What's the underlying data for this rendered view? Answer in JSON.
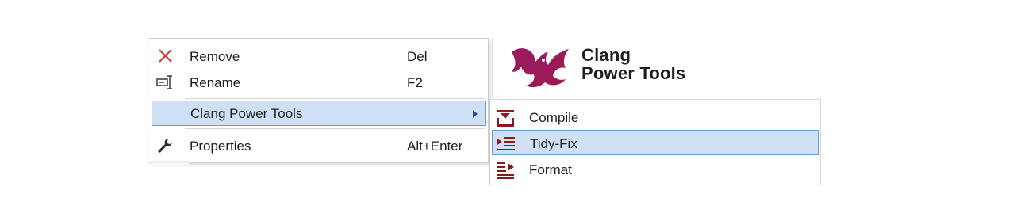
{
  "context_menu": {
    "items": [
      {
        "label": "Remove",
        "shortcut": "Del",
        "icon": "remove-x-icon"
      },
      {
        "label": "Rename",
        "shortcut": "F2",
        "icon": "rename-icon"
      },
      {
        "label": "Clang Power Tools",
        "shortcut": "",
        "icon": "",
        "has_submenu": true,
        "highlighted": true
      },
      {
        "label": "Properties",
        "shortcut": "Alt+Enter",
        "icon": "wrench-icon"
      }
    ]
  },
  "submenu": {
    "items": [
      {
        "label": "Compile",
        "icon": "compile-icon"
      },
      {
        "label": "Tidy-Fix",
        "icon": "tidy-fix-icon",
        "highlighted": true
      },
      {
        "label": "Format",
        "icon": "format-icon"
      }
    ]
  },
  "logo": {
    "line1": "Clang",
    "line2": "Power Tools",
    "icon": "dragon-logo-icon",
    "color": "#9b1b5a"
  },
  "colors": {
    "highlight_bg": "#cfe0f4",
    "highlight_border": "#6a9dd3",
    "icon_red": "#8b1a1a",
    "remove_red": "#d13438"
  }
}
